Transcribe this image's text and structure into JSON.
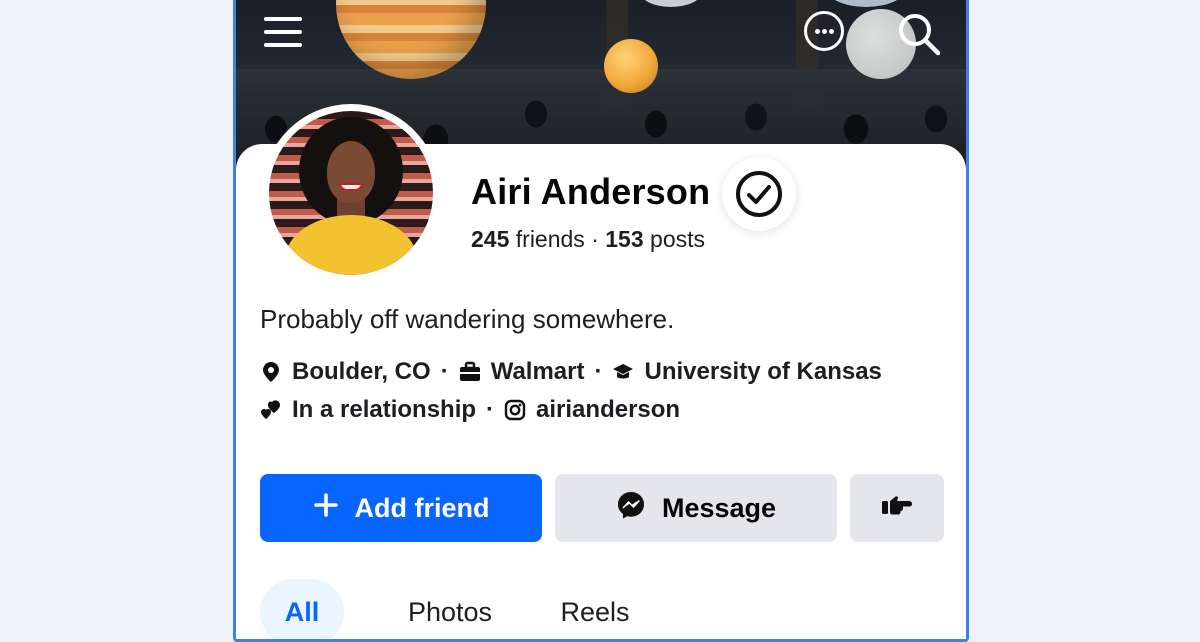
{
  "header": {
    "menu_icon": "hamburger-menu-icon",
    "more_icon": "more-horizontal-icon",
    "search_icon": "search-icon"
  },
  "profile": {
    "name": "Airi Anderson",
    "verified_icon": "verified-check-icon",
    "friends_count": "245",
    "friends_label": "friends",
    "stats_separator": "·",
    "posts_count": "153",
    "posts_label": "posts",
    "bio": "Probably off wandering somewhere."
  },
  "details": {
    "separator": "·",
    "location": {
      "icon": "location-pin-icon",
      "text": "Boulder, CO"
    },
    "work": {
      "icon": "briefcase-icon",
      "text": "Walmart"
    },
    "education": {
      "icon": "graduation-cap-icon",
      "text": "University of Kansas"
    },
    "relationship": {
      "icon": "hearts-icon",
      "text": "In a relationship"
    },
    "instagram": {
      "icon": "instagram-icon",
      "text": "airianderson"
    }
  },
  "actions": {
    "add_friend_label": "Add friend",
    "add_friend_icon": "plus-icon",
    "message_label": "Message",
    "message_icon": "messenger-icon",
    "poke_icon": "poke-hand-icon"
  },
  "tabs": [
    {
      "label": "All",
      "active": true
    },
    {
      "label": "Photos",
      "active": false
    },
    {
      "label": "Reels",
      "active": false
    }
  ],
  "colors": {
    "primary": "#0866ff",
    "secondary_button": "#e4e6eb",
    "frame_border": "#3d82e8",
    "active_tab_bg": "#ebf5ff"
  }
}
